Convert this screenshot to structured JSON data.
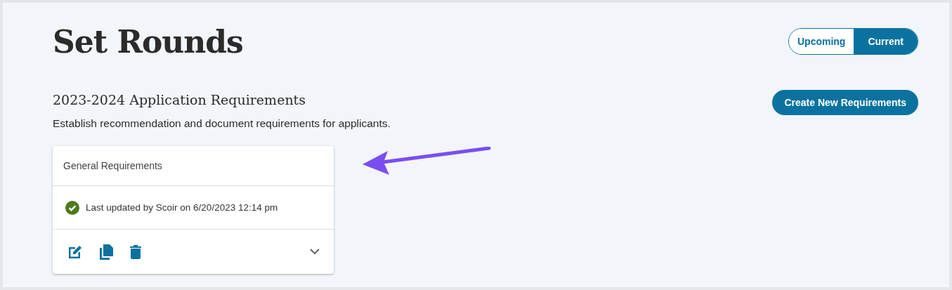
{
  "page": {
    "title": "Set Rounds"
  },
  "toggle": [
    {
      "label": "Upcoming",
      "selected": false
    },
    {
      "label": "Current",
      "selected": true
    }
  ],
  "section": {
    "title": "2023-2024 Application Requirements",
    "description": "Establish recommendation and document requirements for applicants.",
    "button": "Create New Requirements"
  },
  "card": {
    "title": "General Requirements",
    "status": "Last updated by Scoir on 6/20/2023 12:14 pm",
    "expanded": false
  }
}
